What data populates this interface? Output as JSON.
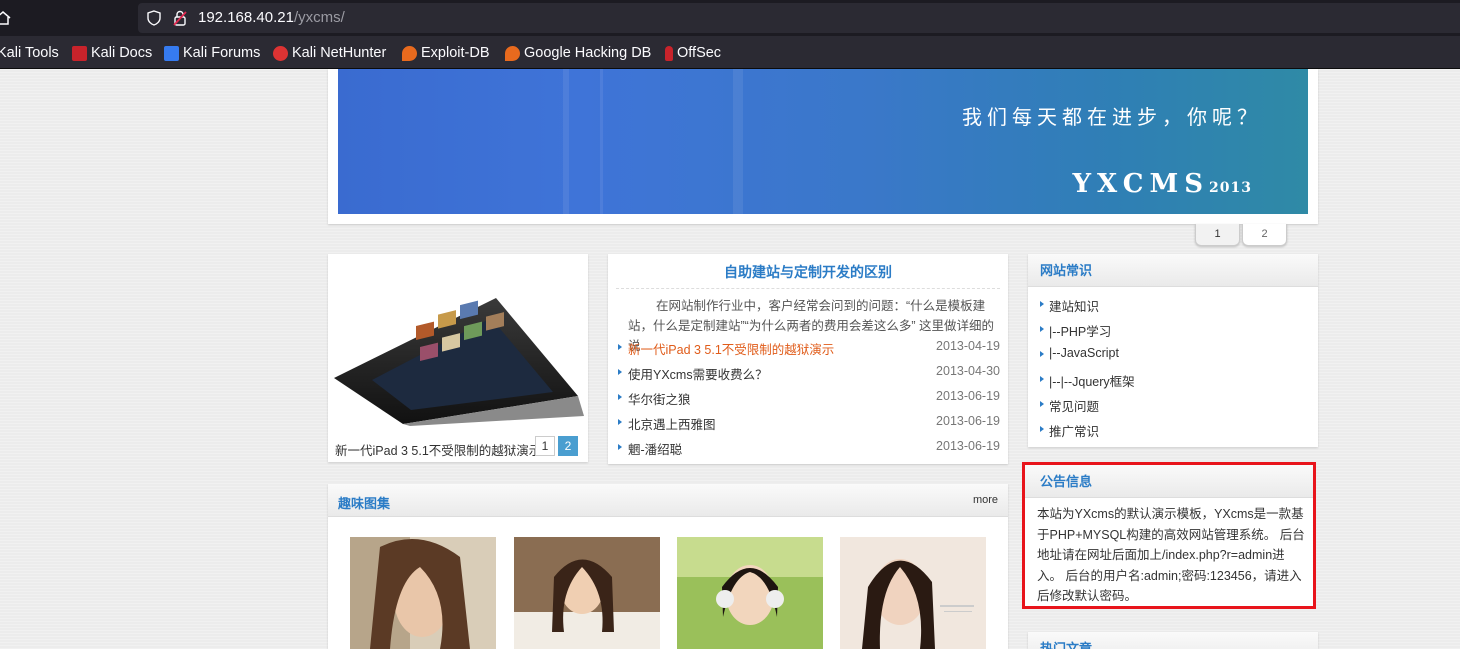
{
  "browser": {
    "url_host": "192.168.40.21",
    "url_path": "/yxcms/",
    "bookmarks": [
      {
        "label": "Kali Tools",
        "icon": "kali-tools-icon"
      },
      {
        "label": "Kali Docs",
        "icon": "kali-docs-icon"
      },
      {
        "label": "Kali Forums",
        "icon": "kali-forums-icon"
      },
      {
        "label": "Kali NetHunter",
        "icon": "kali-nethunter-icon"
      },
      {
        "label": "Exploit-DB",
        "icon": "exploit-db-icon"
      },
      {
        "label": "Google Hacking DB",
        "icon": "ghdb-icon"
      },
      {
        "label": "OffSec",
        "icon": "offsec-icon"
      }
    ]
  },
  "banner": {
    "slogan": "我们每天都在进步，你呢？",
    "brand": "YXCMS",
    "brand_year": "2013",
    "pages": [
      "1",
      "2"
    ]
  },
  "slideshow": {
    "caption": "新一代iPad 3 5.1不受限制的越狱演示",
    "pages": [
      "1",
      "2"
    ],
    "active_page": "2"
  },
  "article": {
    "title": "自助建站与定制开发的区别",
    "summary": "在网站制作行业中，客户经常会问到的问题：“什么是模板建站，什么是定制建站”“为什么两者的费用会差这么多” 这里做详细的说",
    "news": [
      {
        "title": "新一代iPad 3 5.1不受限制的越狱演示",
        "date": "2013-04-19",
        "hot": true
      },
      {
        "title": "使用YXcms需要收费么？",
        "date": "2013-04-30",
        "hot": false
      },
      {
        "title": "华尔街之狼",
        "date": "2013-06-19",
        "hot": false
      },
      {
        "title": "北京遇上西雅图",
        "date": "2013-06-19",
        "hot": false
      },
      {
        "title": "魍-潘绍聪",
        "date": "2013-06-19",
        "hot": false
      }
    ]
  },
  "sidebar": {
    "category_title": "网站常识",
    "categories": [
      "建站知识",
      "|--PHP学习",
      "|--JavaScript",
      "|--|--Jquery框架",
      "常见问题",
      "推广常识"
    ],
    "notice_title": "公告信息",
    "notice_text": "本站为YXcms的默认演示模板，YXcms是一款基于PHP+MYSQL构建的高效网站管理系统。 后台地址请在网址后面加上/index.php?r=admin进入。 后台的用户名:admin;密码:123456，请进入后修改默认密码。",
    "hot_title": "热门文章"
  },
  "gallery": {
    "title": "趣味图集",
    "more": "more",
    "thumbs": [
      "photo-woman-windswept",
      "photo-woman-smiling",
      "photo-woman-headphones",
      "photo-woman-portrait"
    ]
  },
  "colors": {
    "accent": "#2b7cc6",
    "hot_link": "#e05c1a",
    "highlight_border": "#e8141b",
    "banner_blue": "#3a6bd0"
  }
}
